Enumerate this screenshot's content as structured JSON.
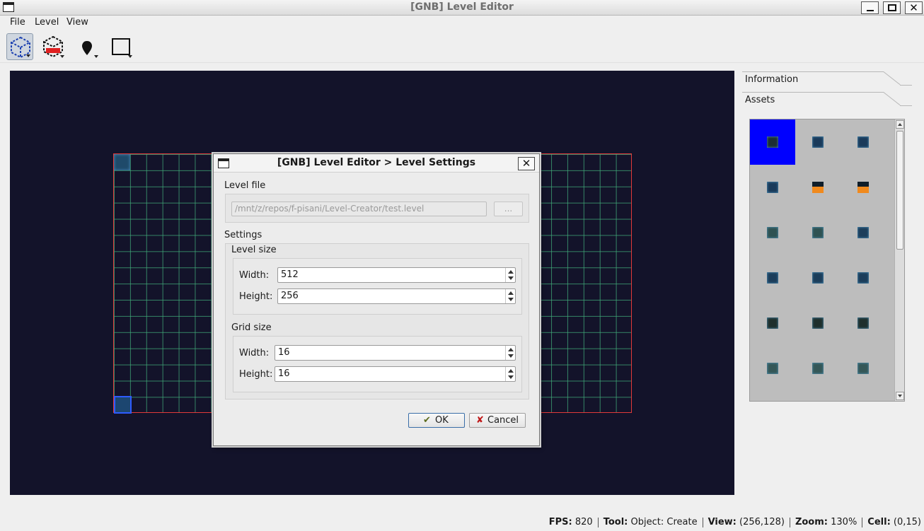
{
  "window": {
    "title": "[GNB] Level Editor"
  },
  "menubar": {
    "items": [
      "File",
      "Level",
      "View"
    ]
  },
  "toolbar": {
    "tools": [
      {
        "name": "object-select-tool",
        "icon": "cube-icon",
        "active": true
      },
      {
        "name": "object-delete-tool",
        "icon": "cube-delete-icon",
        "active": false
      },
      {
        "name": "marker-tool",
        "icon": "map-pin-icon",
        "active": false
      },
      {
        "name": "region-tool",
        "icon": "rectangle-select-icon",
        "active": false
      }
    ]
  },
  "side_panel": {
    "tabs": [
      "Information",
      "Assets"
    ],
    "assets": [
      [
        "#1c2e35",
        "#1a3a5a",
        "#1a3a5a"
      ],
      [
        "#1a3a5a",
        "#f08a1e",
        "#f08a1e"
      ],
      [
        "#2f5252",
        "#2f5252",
        "#1c3d5a"
      ],
      [
        "#1c3d5a",
        "#1c3d5a",
        "#1c3d5a"
      ],
      [
        "#1f2f2c",
        "#1f2f2c",
        "#1f2f2c"
      ],
      [
        "#355757",
        "#355757",
        "#355757"
      ]
    ],
    "selected_asset_color": "#0000ff"
  },
  "status": {
    "fps_label": "FPS:",
    "fps": "820",
    "tool_label": "Tool:",
    "tool": "Object: Create",
    "view_label": "View:",
    "view": "(256,128)",
    "zoom_label": "Zoom:",
    "zoom": "130%",
    "cell_label": "Cell:",
    "cell": "(0,15)"
  },
  "dialog": {
    "title": "[GNB] Level Editor > Level Settings",
    "level_file_label": "Level file",
    "level_file_path": "/mnt/z/repos/f-pisani/Level-Creator/test.level",
    "browse_label": "...",
    "settings_label": "Settings",
    "level_size": {
      "label": "Level size",
      "width_label": "Width:",
      "width": "512",
      "height_label": "Height:",
      "height": "256"
    },
    "grid_size": {
      "label": "Grid size",
      "width_label": "Width:",
      "width": "16",
      "height_label": "Height:",
      "height": "16"
    },
    "ok_label": "OK",
    "cancel_label": "Cancel"
  },
  "colors": {
    "canvas_bg": "#13132a",
    "level_border": "#e23a3a",
    "grid_line": "#40aa78"
  }
}
